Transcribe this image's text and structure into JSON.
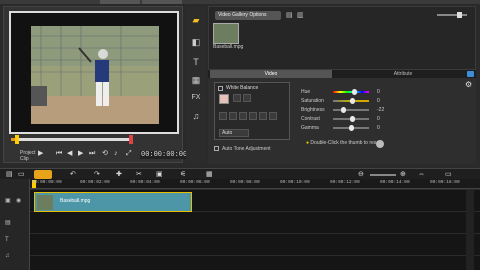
{
  "preview": {
    "mode_project": "Project",
    "mode_clip": "Clip",
    "timecode": "00:00:00:00",
    "scrub_progress": 0.04
  },
  "library": {
    "folder": "Video Gallery Options",
    "thumbnail_label": "Baseball.mpg"
  },
  "options": {
    "tab_video": "Video",
    "tab_attribute": "Attribute",
    "white_balance": "White Balance",
    "wb_mode": "Auto",
    "auto_tone": "Auto Tone Adjustment",
    "adjustments": [
      {
        "name": "Hue",
        "value": "0",
        "pos": 0.6
      },
      {
        "name": "Saturation",
        "value": "0",
        "pos": 0.55
      },
      {
        "name": "Brightness",
        "value": "-22",
        "pos": 0.3
      },
      {
        "name": "Contrast",
        "value": "0",
        "pos": 0.55
      },
      {
        "name": "Gamma",
        "value": "0",
        "pos": 0.5
      }
    ],
    "hint": "Double-Click the thumb to reset"
  },
  "timeline": {
    "ruler_ticks": [
      "00:00:00:00",
      "00:00:02:00",
      "00:00:04:00",
      "00:00:06:00",
      "00:00:08:00",
      "00:00:10:00",
      "00:00:12:00",
      "00:00:14:00",
      "00:00:16:00"
    ],
    "clip_name": "Baseball.mpg"
  },
  "colors": {
    "accent": "#e7a31a",
    "clip": "#4c96a8"
  }
}
